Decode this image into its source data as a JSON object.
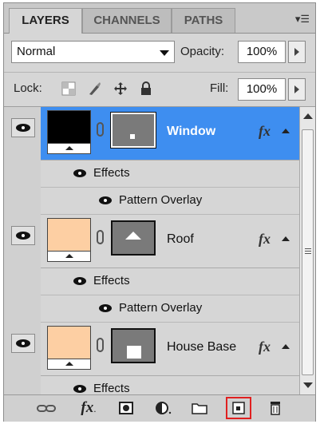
{
  "tabs": [
    {
      "label": "LAYERS",
      "active": true
    },
    {
      "label": "CHANNELS",
      "active": false
    },
    {
      "label": "PATHS",
      "active": false
    }
  ],
  "panel_menu_icon": "panel-menu-icon",
  "blend_mode": "Normal",
  "opacity": {
    "label": "Opacity:",
    "value": "100%"
  },
  "lock_label": "Lock:",
  "fill": {
    "label": "Fill:",
    "value": "100%"
  },
  "layers": [
    {
      "name": "Window",
      "selected": true,
      "thumb_color": "#000000",
      "mask_shape": "small-square"
    },
    {
      "name": "Roof",
      "selected": false,
      "thumb_color": "#fdcfa3",
      "mask_shape": "triangle"
    },
    {
      "name": "House Base",
      "selected": false,
      "thumb_color": "#fdcfa3",
      "mask_shape": "square"
    }
  ],
  "effects_label": "Effects",
  "pattern_overlay_label": "Pattern Overlay",
  "fx_label": "fx",
  "bottom_icons": [
    "link-layers-icon",
    "layer-style-icon",
    "layer-mask-icon",
    "adjustment-layer-icon",
    "new-group-icon",
    "new-layer-icon",
    "delete-layer-icon"
  ],
  "colors": {
    "selection": "#3e8ef0",
    "highlight": "#e02020"
  }
}
